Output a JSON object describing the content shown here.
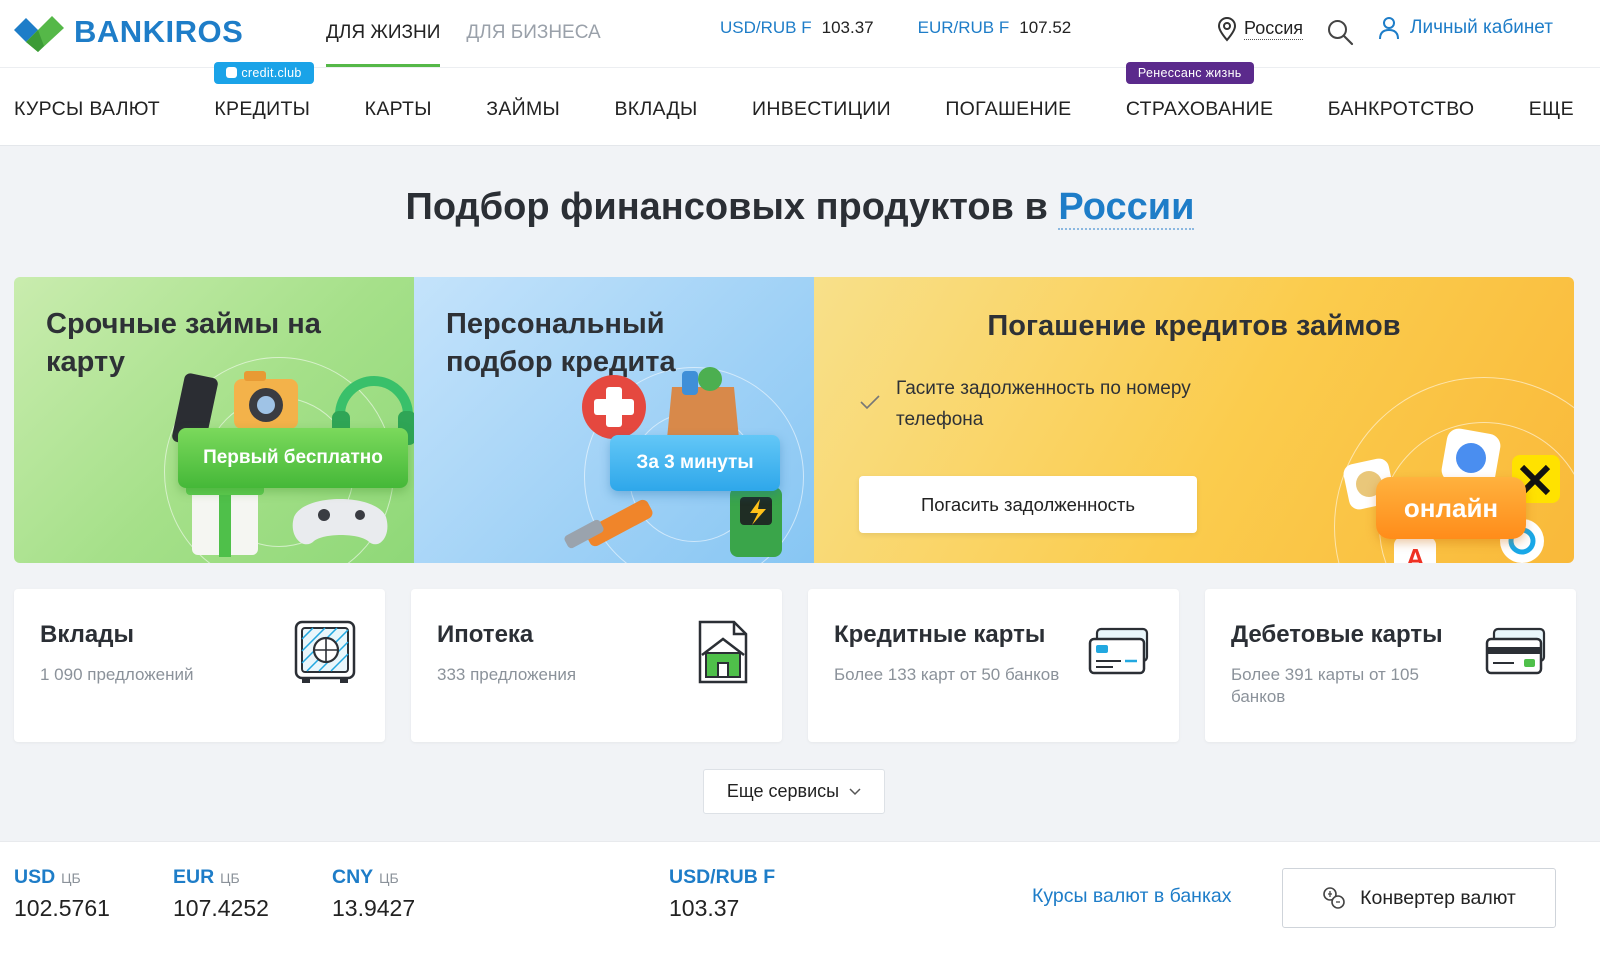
{
  "brand": {
    "name": "BANKIROS",
    "green": "#55b848",
    "blue": "#1e7dc8"
  },
  "segments": [
    {
      "label": "ДЛЯ ЖИЗНИ",
      "active": true
    },
    {
      "label": "ДЛЯ БИЗНЕСА",
      "active": false
    }
  ],
  "top_rates": [
    {
      "pair": "USD/RUB F",
      "value": "103.37"
    },
    {
      "pair": "EUR/RUB F",
      "value": "107.52"
    }
  ],
  "region": {
    "label": "Россия",
    "icon": "location-pin-icon"
  },
  "search": {
    "icon": "search-icon"
  },
  "account": {
    "label": "Личный кабинет",
    "icon": "user-icon"
  },
  "nav": {
    "items": [
      {
        "label": "КУРСЫ ВАЛЮТ"
      },
      {
        "label": "КРЕДИТЫ",
        "badge": "credit.club"
      },
      {
        "label": "КАРТЫ"
      },
      {
        "label": "ЗАЙМЫ"
      },
      {
        "label": "ВКЛАДЫ"
      },
      {
        "label": "ИНВЕСТИЦИИ"
      },
      {
        "label": "ПОГАШЕНИЕ"
      },
      {
        "label": "СТРАХОВАНИЕ",
        "badge": "Ренессанс жизнь"
      },
      {
        "label": "БАНКРОТСТВО"
      },
      {
        "label": "ЕЩЕ"
      }
    ]
  },
  "title": {
    "prefix": "Подбор финансовых продуктов в ",
    "highlight": "России"
  },
  "promos": {
    "loans": {
      "title": "Срочные займы на карту",
      "tag": "Первый бесплатно"
    },
    "credit": {
      "title": "Персональный подбор кредита",
      "tag": "За 3 минуты"
    },
    "repay": {
      "title": "Погашение кредитов займов",
      "check_text": "Гасите задолженность по номеру телефона",
      "button": "Погасить задолженность",
      "tag": "онлайн"
    }
  },
  "cards": [
    {
      "title": "Вклады",
      "sub": "1 090 предложений",
      "icon": "safe-icon"
    },
    {
      "title": "Ипотека",
      "sub": "333 предложения",
      "icon": "house-document-icon"
    },
    {
      "title": "Кредитные карты",
      "sub": "Более 133 карт от 50 банков",
      "icon": "credit-card-icon"
    },
    {
      "title": "Дебетовые карты",
      "sub": "Более 391 карты от 105 банков",
      "icon": "debit-card-icon"
    }
  ],
  "more_services": {
    "label": "Еще сервисы"
  },
  "bottom_rates": [
    {
      "code": "USD",
      "src": "ЦБ",
      "value": "102.5761"
    },
    {
      "code": "EUR",
      "src": "ЦБ",
      "value": "107.4252"
    },
    {
      "code": "CNY",
      "src": "ЦБ",
      "value": "13.9427"
    },
    {
      "code": "USD/RUB F",
      "src": "",
      "value": "103.37"
    }
  ],
  "banks_link": "Курсы валют в банках",
  "converter": {
    "label": "Конвертер валют",
    "icon": "currency-exchange-icon"
  }
}
